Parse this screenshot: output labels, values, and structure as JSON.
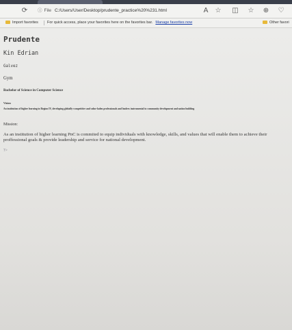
{
  "browser": {
    "address": {
      "scheme": "File",
      "url": "C:/Users/User/Desktop/prudente_practice%20%231.html"
    },
    "favorites_bar": {
      "import_label": "Import favorites",
      "hint": "For quick access, place your favorites here on the favorites bar.",
      "manage_link": "Manage favorites now",
      "other_label": "Other favori"
    }
  },
  "page": {
    "title": "Prudente",
    "name": "Kin Edrian",
    "middle": "Galvez",
    "section": "Gym",
    "degree": "Bachelor of Science in Computer Science",
    "vision_heading": "Vision",
    "vision_text": "An institution of higher learning in Region IV, developing globally-competitive and value-laden professionals and leaders instrumental to community development and nation building",
    "mission_heading": "Mission:",
    "mission_text": "As an institution of higher learning PnC is commited to equip individuals with knowledge, skills, and values that will enable them to achieve their proffessional goals & provide leadership and service for national development.",
    "stray_text": "?>"
  }
}
